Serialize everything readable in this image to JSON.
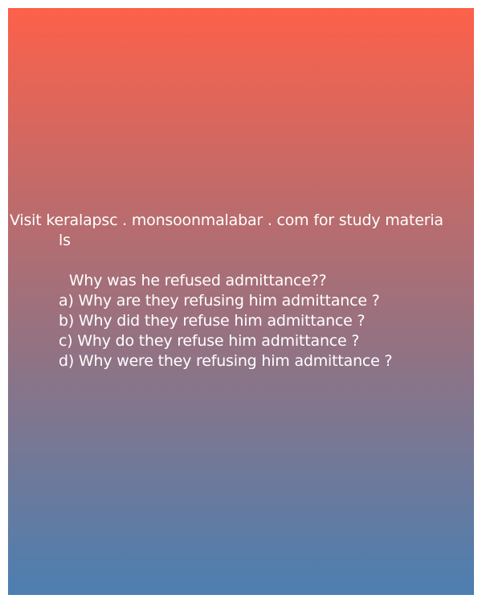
{
  "header": {
    "line1": "Visit keralapsc . monsoonmalabar . com for study materia",
    "line2": "ls"
  },
  "question": {
    "text": " Why was he refused admittance??"
  },
  "options": [
    "a) Why are they refusing him admittance ?",
    "b) Why did they refuse him admittance ?",
    "c) Why do they refuse him admittance ?",
    "d) Why were they refusing him admittance ?"
  ],
  "colors": {
    "gradient_top": "#fd614a",
    "gradient_bottom": "#4c7fb1",
    "text": "#ffffff"
  }
}
